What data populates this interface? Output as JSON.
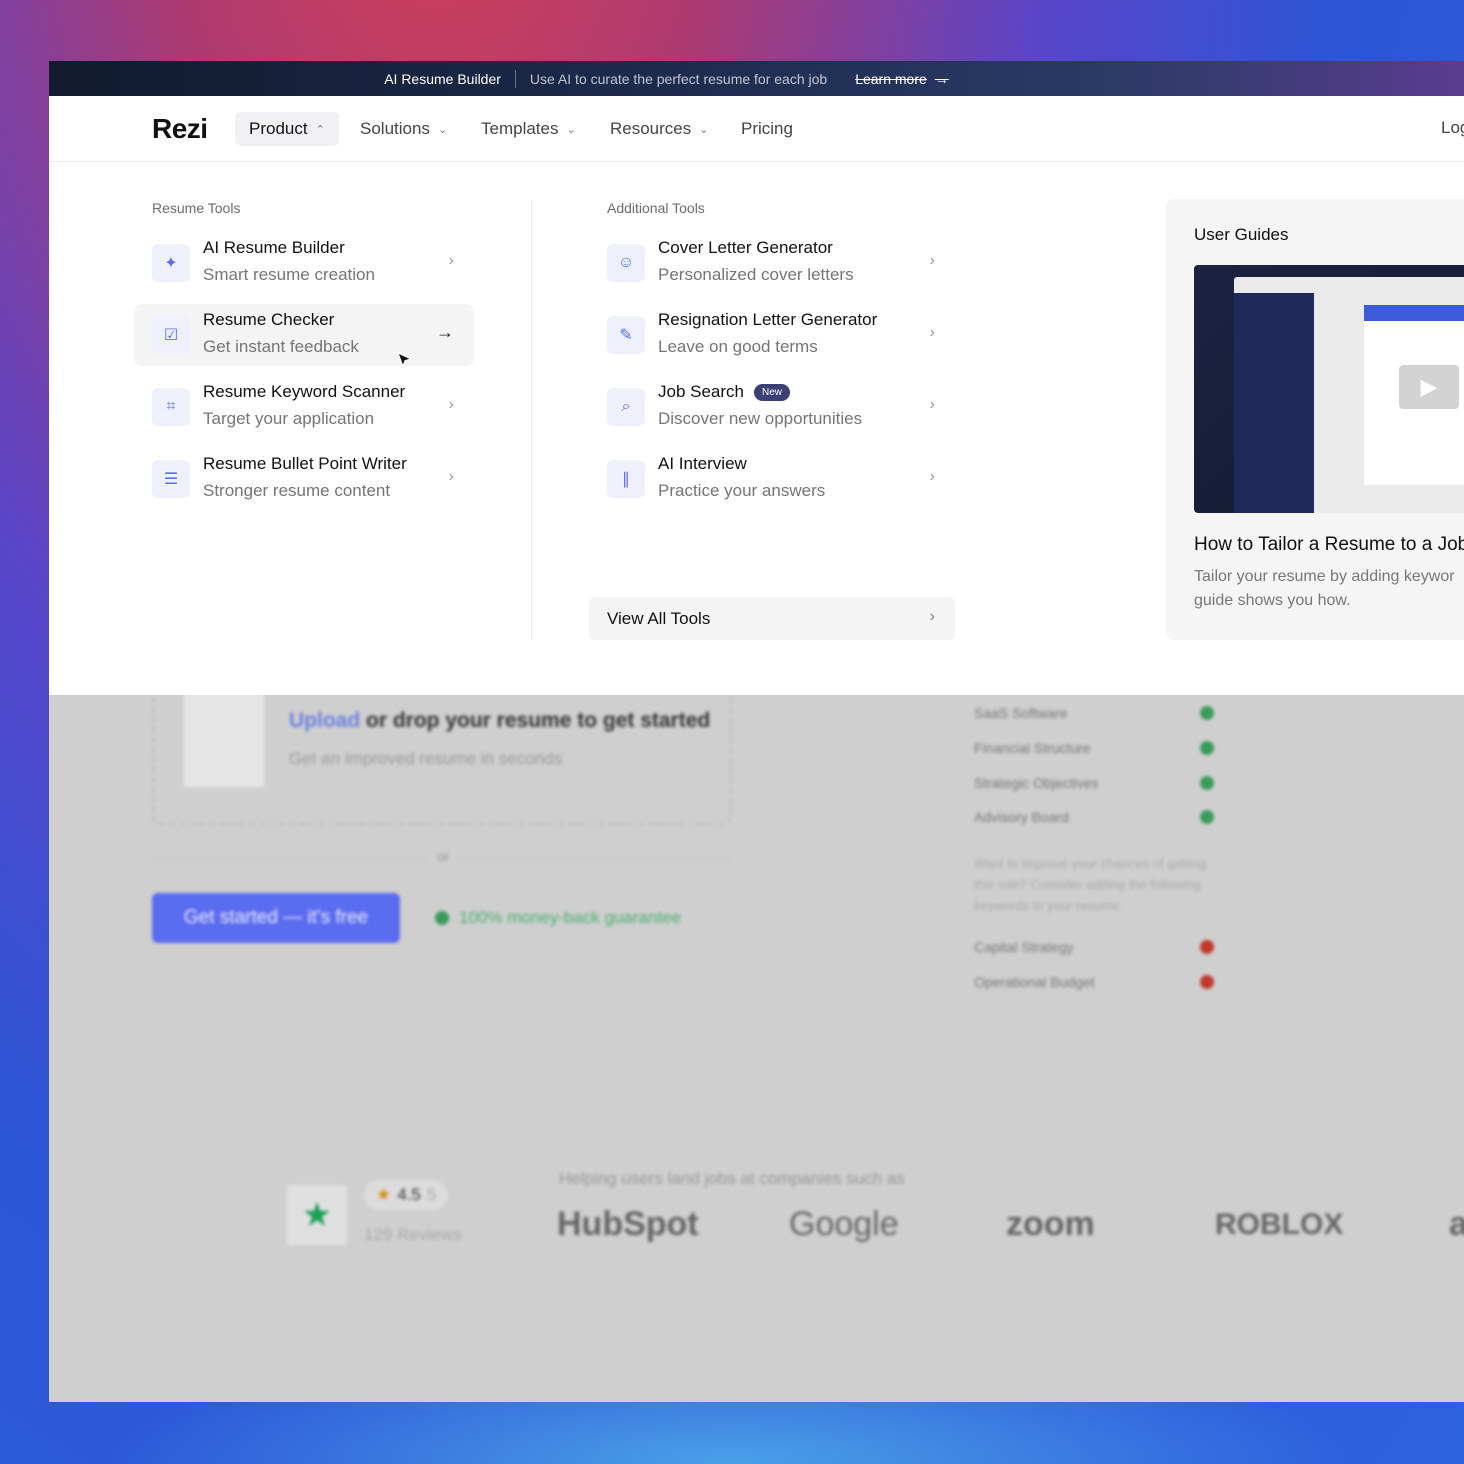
{
  "announcement": {
    "product": "AI Resume Builder",
    "description": "Use AI to curate the perfect resume for each job",
    "link": "Learn more",
    "link_icon": "→"
  },
  "nav": {
    "logo": "Rezi",
    "items": [
      {
        "label": "Product",
        "icon": "⌃"
      },
      {
        "label": "Solutions",
        "icon": "⌄"
      },
      {
        "label": "Templates",
        "icon": "⌄"
      },
      {
        "label": "Resources",
        "icon": "⌄"
      },
      {
        "label": "Pricing"
      }
    ],
    "login": "Log"
  },
  "dropdown": {
    "resume_tools": {
      "title": "Resume Tools",
      "items": [
        {
          "title": "AI Resume Builder",
          "subtitle": "Smart resume creation",
          "icon": "sparkle-list-icon"
        },
        {
          "title": "Resume Checker",
          "subtitle": "Get instant feedback",
          "icon": "checklist-icon"
        },
        {
          "title": "Resume Keyword Scanner",
          "subtitle": "Target your application",
          "icon": "scan-icon"
        },
        {
          "title": "Resume Bullet Point Writer",
          "subtitle": "Stronger resume content",
          "icon": "bullet-list-icon"
        }
      ]
    },
    "additional_tools": {
      "title": "Additional Tools",
      "items": [
        {
          "title": "Cover Letter Generator",
          "subtitle": "Personalized cover letters",
          "icon": "portrait-sparkle-icon"
        },
        {
          "title": "Resignation Letter Generator",
          "subtitle": "Leave on good terms",
          "icon": "document-edit-icon"
        },
        {
          "title": "Job Search",
          "subtitle": "Discover new opportunities",
          "icon": "search-list-icon",
          "badge": "New"
        },
        {
          "title": "AI Interview",
          "subtitle": "Practice your answers",
          "icon": "audio-wave-icon"
        }
      ],
      "view_all": "View All Tools"
    },
    "user_guides": {
      "title": "User Guides",
      "video_title": "How to Tailor a Resume to a Job",
      "video_desc_line1": "Tailor your resume by adding keywor",
      "video_desc_line2": "guide shows you how."
    }
  },
  "background": {
    "upload_link": "Upload",
    "upload_rest": " or drop your resume to get started",
    "upload_sub": "Get an improved resume in seconds",
    "or": "or",
    "cta": "Get started — it's free",
    "guarantee": "100% money-back guarantee",
    "keywords_matched": [
      "SaaS Software",
      "Financial Structure",
      "Strategic Objectives",
      "Advisory Board"
    ],
    "keywords_note": "Want to improve your chances of getting this role? Consider adding the following keywords to your resume.",
    "keywords_missing": [
      "Capital Strategy",
      "Operational Budget"
    ],
    "rating": "4.5",
    "rating_outof": "5",
    "reviews": "129 Reviews",
    "helping": "Helping users land jobs at companies such as",
    "companies": [
      "HubSpot",
      "Google",
      "zoom",
      "ROBLOX",
      "a"
    ]
  },
  "colors": {
    "accent": "#5b6ee8",
    "badge": "#3a3f74",
    "success": "#3a9a5a",
    "danger": "#c0392b"
  }
}
